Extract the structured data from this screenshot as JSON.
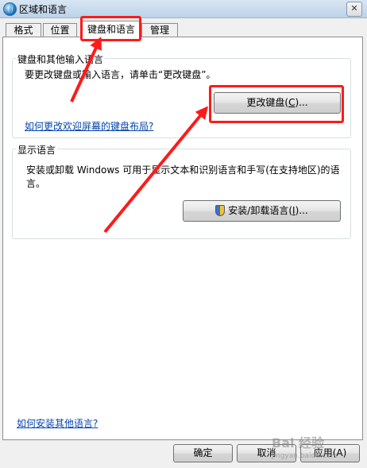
{
  "window": {
    "title": "区域和语言",
    "close_label": "✕"
  },
  "tabs": [
    {
      "label": "格式"
    },
    {
      "label": "位置"
    },
    {
      "label": "键盘和语言",
      "active": true
    },
    {
      "label": "管理"
    }
  ],
  "keyboard_group": {
    "legend": "键盘和其他输入语言",
    "description": "要更改键盘或输入语言，请单击“更改键盘”。",
    "change_button_label": "更改键盘(",
    "change_button_key": "C",
    "change_button_suffix": ")...",
    "welcome_link": "如何更改欢迎屏幕的键盘布局?"
  },
  "display_group": {
    "legend": "显示语言",
    "description": "安装或卸载 Windows 可用于显示文本和识别语言和手写(在支持地区)的语言。",
    "install_button_label": "安装/卸载语言(",
    "install_button_key": "I",
    "install_button_suffix": ")..."
  },
  "footer": {
    "install_other_link": "如何安装其他语言?",
    "ok_label": "确定",
    "cancel_label": "取消",
    "apply_label": "应用(A)"
  },
  "watermark": {
    "brand": "Bai 经验",
    "url": "jingyan.baidu.com"
  },
  "colors": {
    "highlight": "#ff1a1a",
    "link": "#0645ad"
  }
}
